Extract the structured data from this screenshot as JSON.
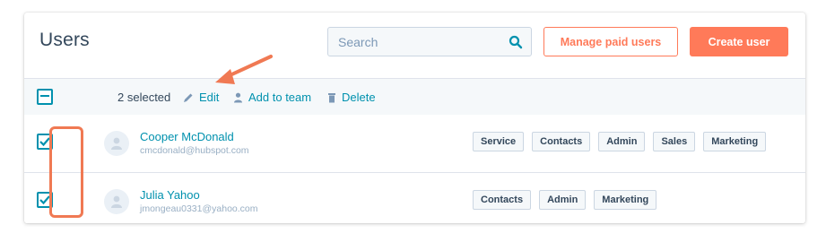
{
  "header": {
    "title": "Users",
    "search_placeholder": "Search",
    "manage_label": "Manage paid users",
    "create_label": "Create user"
  },
  "bulk": {
    "selected": "2 selected",
    "edit": "Edit",
    "add_team": "Add to team",
    "delete": "Delete"
  },
  "users": [
    {
      "name": "Cooper McDonald",
      "email": "cmcdonald@hubspot.com",
      "checked": true,
      "teams": [
        "Service",
        "Contacts",
        "Admin",
        "Sales",
        "Marketing"
      ]
    },
    {
      "name": "Julia Yahoo",
      "email": "jmongeau0331@yahoo.com",
      "checked": true,
      "teams": [
        "Contacts",
        "Admin",
        "Marketing"
      ]
    }
  ],
  "colors": {
    "accent": "#ff7a59",
    "link": "#0091ae",
    "text": "#33475b",
    "highlight": "#f07953"
  }
}
